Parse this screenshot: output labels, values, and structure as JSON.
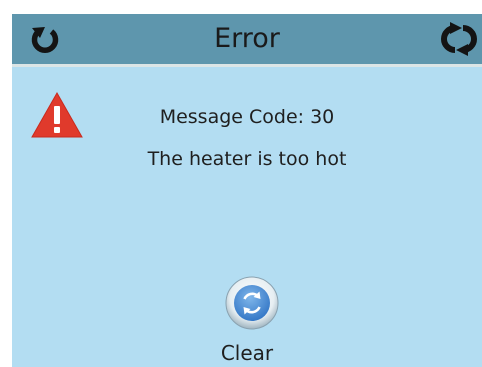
{
  "header": {
    "title": "Error",
    "back_icon": "back-arrow-icon",
    "refresh_icon": "refresh-icon"
  },
  "message": {
    "icon": "warning-icon",
    "code_line": "Message Code: 30",
    "text": "The heater is too hot"
  },
  "actions": {
    "clear_label": "Clear",
    "clear_icon": "refresh-circle-icon"
  },
  "colors": {
    "header_bg": "#5e96ad",
    "screen_bg": "#b3ddf2",
    "warning": "#e03a2c"
  }
}
